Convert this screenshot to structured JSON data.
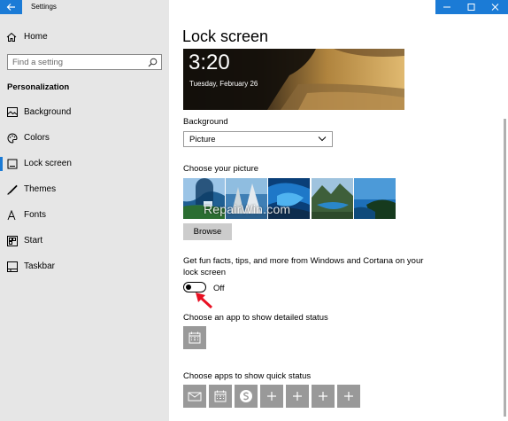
{
  "window": {
    "app_title": "Settings"
  },
  "sidebar": {
    "home_label": "Home",
    "search_placeholder": "Find a setting",
    "section_heading": "Personalization",
    "items": [
      {
        "label": "Background",
        "icon": "picture-icon"
      },
      {
        "label": "Colors",
        "icon": "palette-icon"
      },
      {
        "label": "Lock screen",
        "icon": "lock-screen-icon",
        "selected": true
      },
      {
        "label": "Themes",
        "icon": "brush-icon"
      },
      {
        "label": "Fonts",
        "icon": "font-icon"
      },
      {
        "label": "Start",
        "icon": "start-icon"
      },
      {
        "label": "Taskbar",
        "icon": "taskbar-icon"
      }
    ]
  },
  "main": {
    "title": "Lock screen",
    "preview": {
      "time": "3:20",
      "date": "Tuesday, February 26"
    },
    "background_label": "Background",
    "background_value": "Picture",
    "choose_picture_label": "Choose your picture",
    "watermark": "RepairWin.com",
    "browse_label": "Browse",
    "fun_facts_label_line1": "Get fun facts, tips, and more from Windows and Cortana on your",
    "fun_facts_label_line2": "lock screen",
    "toggle_state": "Off",
    "detailed_status_label": "Choose an app to show detailed status",
    "quick_status_label": "Choose apps to show quick status"
  },
  "colors": {
    "accent": "#1b7bd6",
    "sidebar_bg": "#e6e6e6",
    "tile_bg": "#999999",
    "arrow_red": "#e81123"
  }
}
